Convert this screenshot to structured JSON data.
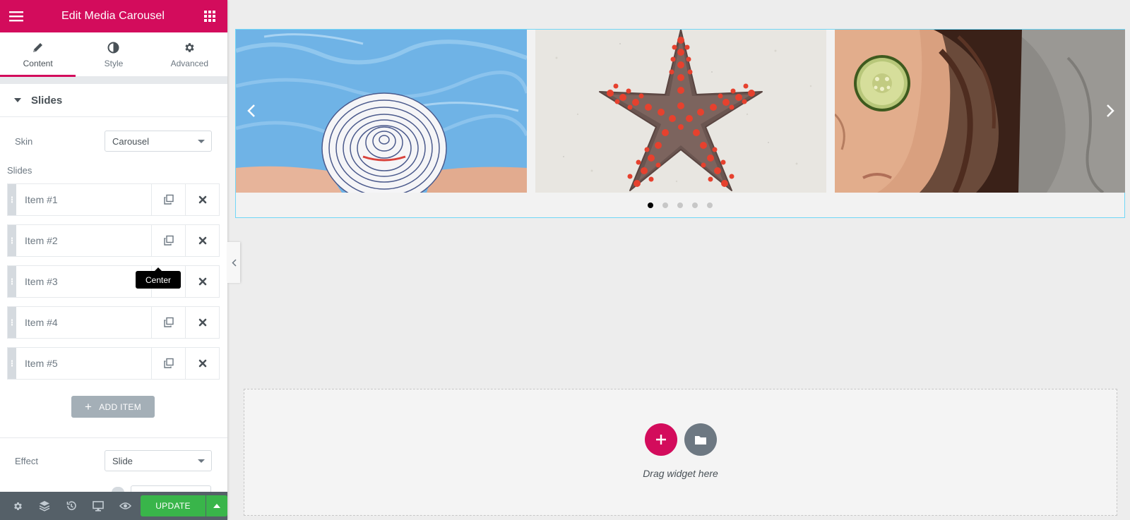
{
  "panel": {
    "title": "Edit Media Carousel",
    "menu_icon": "hamburger-icon",
    "apps_icon": "grid-icon",
    "accent_color": "#d30c5c"
  },
  "tabs": [
    {
      "label": "Content",
      "icon": "pencil-icon",
      "active": true
    },
    {
      "label": "Style",
      "icon": "half-circle-icon",
      "active": false
    },
    {
      "label": "Advanced",
      "icon": "gear-icon",
      "active": false
    }
  ],
  "section": {
    "title": "Slides"
  },
  "skin": {
    "label": "Skin",
    "value": "Carousel"
  },
  "slides_label": "Slides",
  "items": [
    {
      "label": "Item #1"
    },
    {
      "label": "Item #2"
    },
    {
      "label": "Item #3"
    },
    {
      "label": "Item #4"
    },
    {
      "label": "Item #5"
    }
  ],
  "tooltip": "Center",
  "add_item_label": "ADD ITEM",
  "effect": {
    "label": "Effect",
    "value": "Slide"
  },
  "bottom_bar": {
    "icons": [
      "settings-icon",
      "layers-icon",
      "history-icon",
      "responsive-icon",
      "preview-icon"
    ],
    "update_label": "UPDATE"
  },
  "carousel": {
    "slides": [
      "pool-hat",
      "starfish",
      "cucumber-face"
    ],
    "pagination_count": 5,
    "active_dot": 0
  },
  "drop_area": {
    "text": "Drag widget here"
  }
}
